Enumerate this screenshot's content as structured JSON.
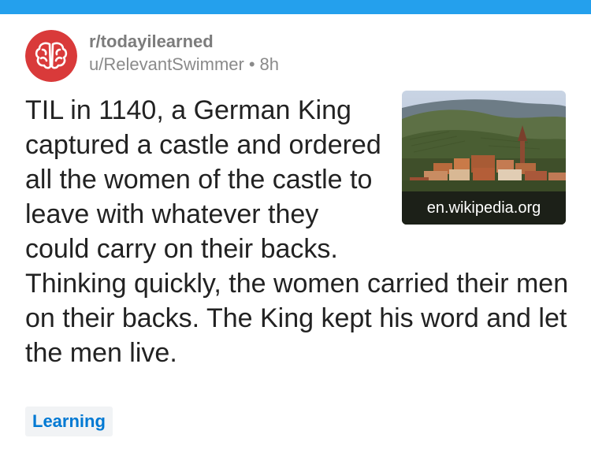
{
  "colors": {
    "top_bar": "#24a0ed",
    "avatar_bg": "#d93a3a",
    "flair_text": "#0079d3",
    "flair_bg": "#f1f3f5"
  },
  "post": {
    "subreddit": "r/todayilearned",
    "author": "u/RelevantSwimmer",
    "separator": "•",
    "time": "8h",
    "title": "TIL in 1140, a German King captured a castle and ordered all the women of the castle to leave with whatever they could carry on their backs. Thinking quickly, the women carried their men on their backs. The King kept his word and let the men live.",
    "thumbnail": {
      "domain": "en.wikipedia.org"
    },
    "flair": "Learning"
  },
  "icons": {
    "avatar": "brain-icon"
  }
}
